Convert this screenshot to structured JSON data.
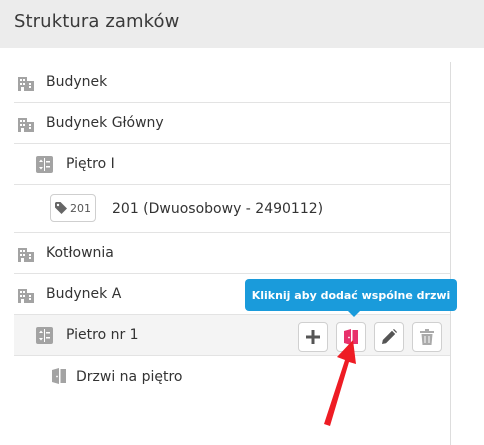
{
  "header": {
    "title": "Struktura zamków"
  },
  "tree": {
    "items": [
      {
        "label": "Budynek",
        "icon": "building-icon"
      },
      {
        "label": "Budynek Główny",
        "icon": "building-icon"
      },
      {
        "label": "Piętro I",
        "icon": "floor-icon"
      },
      {
        "label": "201 (Dwuosobowy - 2490112)",
        "badge": "201",
        "icon": "tag-icon"
      },
      {
        "label": "Kotłownia",
        "icon": "building-icon"
      },
      {
        "label": "Budynek A",
        "icon": "building-icon"
      },
      {
        "label": "Pietro nr 1",
        "icon": "floor-icon",
        "selected": true
      },
      {
        "label": "Drzwi na piętro",
        "icon": "door-icon"
      }
    ]
  },
  "actions": {
    "add": "add-icon",
    "add_door": "door-icon",
    "edit": "pencil-icon",
    "delete": "trash-icon"
  },
  "tooltip": {
    "text": "Kliknij aby dodać wspólne drzwi"
  },
  "colors": {
    "header_bg": "#ececec",
    "tooltip_bg": "#1a9bdb",
    "door_accent": "#e8316b",
    "arrow": "#ee1c24",
    "icon_gray": "#9a9a9a"
  }
}
